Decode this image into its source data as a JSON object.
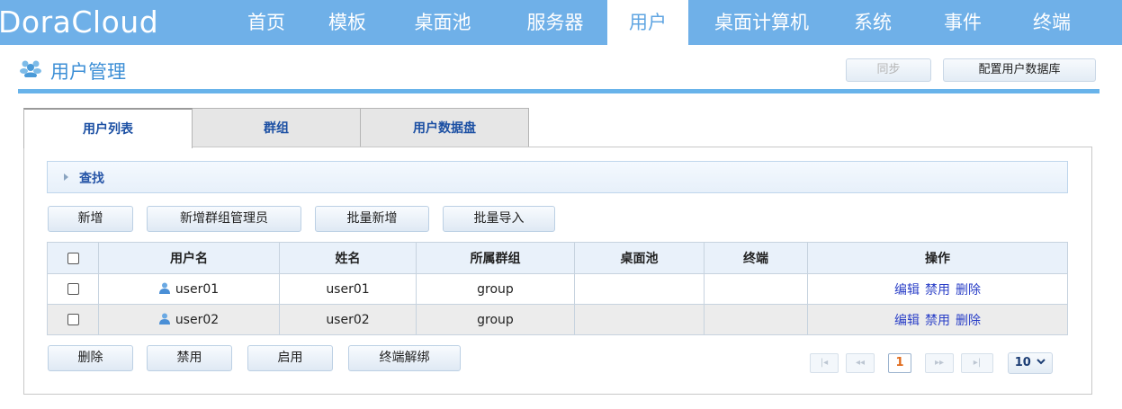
{
  "app": {
    "logo": "DoraCloud"
  },
  "nav": [
    {
      "label": "首页",
      "active": false
    },
    {
      "label": "模板",
      "active": false
    },
    {
      "label": "桌面池",
      "active": false
    },
    {
      "label": "服务器",
      "active": false
    },
    {
      "label": "用户",
      "active": true
    },
    {
      "label": "桌面计算机",
      "active": false
    },
    {
      "label": "系统",
      "active": false
    },
    {
      "label": "事件",
      "active": false
    },
    {
      "label": "终端",
      "active": false
    }
  ],
  "page": {
    "title": "用户管理",
    "sync_label": "同步",
    "config_db_label": "配置用户数据库"
  },
  "tabs": [
    {
      "label": "用户列表",
      "active": true
    },
    {
      "label": "群组",
      "active": false
    },
    {
      "label": "用户数据盘",
      "active": false
    }
  ],
  "search": {
    "label": "查找"
  },
  "toolbar": {
    "add": "新增",
    "add_group_admin": "新增群组管理员",
    "batch_add": "批量新增",
    "batch_import": "批量导入"
  },
  "table": {
    "headers": [
      "用户名",
      "姓名",
      "所属群组",
      "桌面池",
      "终端",
      "操作"
    ],
    "rows": [
      {
        "username": "user01",
        "name": "user01",
        "group": "group",
        "pool": "",
        "terminal": ""
      },
      {
        "username": "user02",
        "name": "user02",
        "group": "group",
        "pool": "",
        "terminal": ""
      }
    ],
    "actions": {
      "edit": "编辑",
      "disable": "禁用",
      "delete": "删除"
    }
  },
  "bottom": {
    "delete": "删除",
    "disable": "禁用",
    "enable": "启用",
    "unbind_terminal": "终端解绑"
  },
  "pagination": {
    "first": "|◂",
    "prev": "◂◂",
    "current": "1",
    "next": "▸▸",
    "last": "▸|",
    "page_size": "10"
  },
  "colors": {
    "nav_bg": "#6fb0e8",
    "accent": "#3d8fd6",
    "link": "#2a3fc7"
  }
}
